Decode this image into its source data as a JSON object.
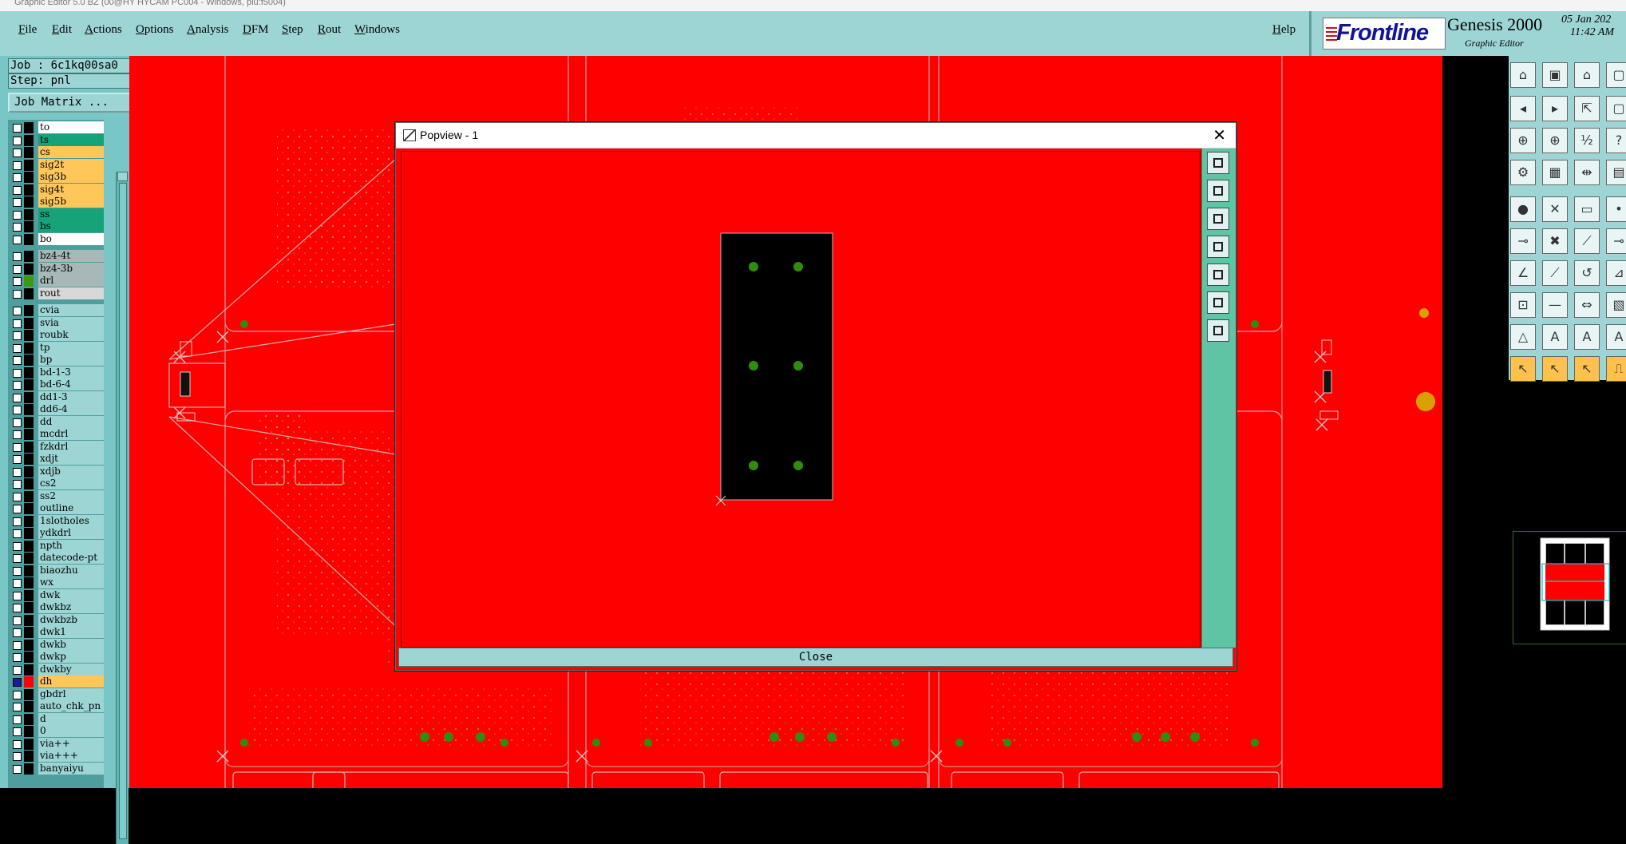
{
  "window": {
    "title": "Graphic Editor 5.0 BZ (00@HY HYCAM PC004 - Windows, plu:f5004)"
  },
  "menu": {
    "items": [
      "File",
      "Edit",
      "Actions",
      "Options",
      "Analysis",
      "DFM",
      "Step",
      "Rout",
      "Windows"
    ],
    "help": "Help"
  },
  "brand": {
    "logo": "Frontline",
    "product": "Genesis 2000",
    "subtitle": "Graphic Editor",
    "date": "05 Jan 202",
    "time": "11:42 AM"
  },
  "job": {
    "job_label": "Job : 6c1kq00sa0",
    "step_label": "Step: pnl",
    "matrix_button": "Job Matrix ..."
  },
  "layers": [
    {
      "name": "to",
      "color": "#ffffff"
    },
    {
      "name": "ts",
      "color": "#16a37a"
    },
    {
      "name": "cs",
      "color": "#ffc65a"
    },
    {
      "name": "sig2t",
      "color": "#ffc65a"
    },
    {
      "name": "sig3b",
      "color": "#ffc65a"
    },
    {
      "name": "sig4t",
      "color": "#ffc65a"
    },
    {
      "name": "sig5b",
      "color": "#ffc65a"
    },
    {
      "name": "ss",
      "color": "#16a37a"
    },
    {
      "name": "bs",
      "color": "#16a37a"
    },
    {
      "name": "bo",
      "color": "#ffffff"
    },
    {
      "name": "bz4-4t",
      "color": "#a8b8b8"
    },
    {
      "name": "bz4-3b",
      "color": "#a8b8b8"
    },
    {
      "name": "drl",
      "color": "#a8b8b8"
    },
    {
      "name": "rout",
      "color": "#d8d8d8"
    },
    {
      "name": "cvia",
      "color": "#9dd5d5"
    },
    {
      "name": "svia",
      "color": "#9dd5d5"
    },
    {
      "name": "roubk",
      "color": "#9dd5d5"
    },
    {
      "name": "tp",
      "color": "#9dd5d5"
    },
    {
      "name": "bp",
      "color": "#9dd5d5"
    },
    {
      "name": "bd-1-3",
      "color": "#9dd5d5"
    },
    {
      "name": "bd-6-4",
      "color": "#9dd5d5"
    },
    {
      "name": "dd1-3",
      "color": "#9dd5d5"
    },
    {
      "name": "dd6-4",
      "color": "#9dd5d5"
    },
    {
      "name": "dd",
      "color": "#9dd5d5"
    },
    {
      "name": "mcdrl",
      "color": "#9dd5d5"
    },
    {
      "name": "fzkdrl",
      "color": "#9dd5d5"
    },
    {
      "name": "xdjt",
      "color": "#9dd5d5"
    },
    {
      "name": "xdjb",
      "color": "#9dd5d5"
    },
    {
      "name": "cs2",
      "color": "#9dd5d5"
    },
    {
      "name": "ss2",
      "color": "#9dd5d5"
    },
    {
      "name": "outline",
      "color": "#9dd5d5"
    },
    {
      "name": "1slotholes",
      "color": "#9dd5d5"
    },
    {
      "name": "ydkdrl",
      "color": "#9dd5d5"
    },
    {
      "name": "npth",
      "color": "#9dd5d5"
    },
    {
      "name": "datecode-pt",
      "color": "#9dd5d5"
    },
    {
      "name": "biaozhu",
      "color": "#9dd5d5"
    },
    {
      "name": "wx",
      "color": "#9dd5d5"
    },
    {
      "name": "dwk",
      "color": "#9dd5d5"
    },
    {
      "name": "dwkbz",
      "color": "#9dd5d5"
    },
    {
      "name": "dwkbzb",
      "color": "#9dd5d5"
    },
    {
      "name": "dwk1",
      "color": "#9dd5d5"
    },
    {
      "name": "dwkb",
      "color": "#9dd5d5"
    },
    {
      "name": "dwkp",
      "color": "#9dd5d5"
    },
    {
      "name": "dwkby",
      "color": "#9dd5d5"
    },
    {
      "name": "dh",
      "color": "#ffc65a"
    },
    {
      "name": "gbdrl",
      "color": "#9dd5d5"
    },
    {
      "name": "auto_chk_pn",
      "color": "#9dd5d5"
    },
    {
      "name": "d",
      "color": "#9dd5d5"
    },
    {
      "name": "0",
      "color": "#9dd5d5"
    },
    {
      "name": "via++",
      "color": "#9dd5d5"
    },
    {
      "name": "via+++",
      "color": "#9dd5d5"
    },
    {
      "name": "banyaiyu",
      "color": "#9dd5d5"
    }
  ],
  "popview": {
    "title": "Popview - 1",
    "close_glyph": "✕",
    "close_button": "Close"
  },
  "toolbar_icons": [
    "zoom-home-icon",
    "zoom-page-icon",
    "home-icon",
    "frame-icon",
    "zoom-back-icon",
    "zoom-forward-icon",
    "zoom-fit-icon",
    "frame2-icon",
    "zoom-area-icon",
    "zoom-in-icon",
    "scale-icon",
    "help-icon",
    "panel-icon",
    "grid-icon",
    "ruler-icon",
    "layers-icon",
    "snap-center-icon",
    "snap-intersect-icon",
    "measure-icon",
    "snap-point-icon",
    "add-line-icon",
    "delete-icon",
    "edit-line-icon",
    "split-icon",
    "angle-icon",
    "line-icon",
    "arc-icon",
    "slope-icon",
    "move-icon",
    "break-icon",
    "fuse-icon",
    "hatch-icon",
    "triangle-icon",
    "text-a-icon",
    "text-bold-icon",
    "text-outline-icon",
    "select-icon",
    "select-alt-icon",
    "select-area-icon",
    "select-step-icon"
  ],
  "colors": {
    "canvas": "#ff0000",
    "panel": "#9dd5d5",
    "pad": "#3a9a14",
    "brand": "#13139a"
  }
}
